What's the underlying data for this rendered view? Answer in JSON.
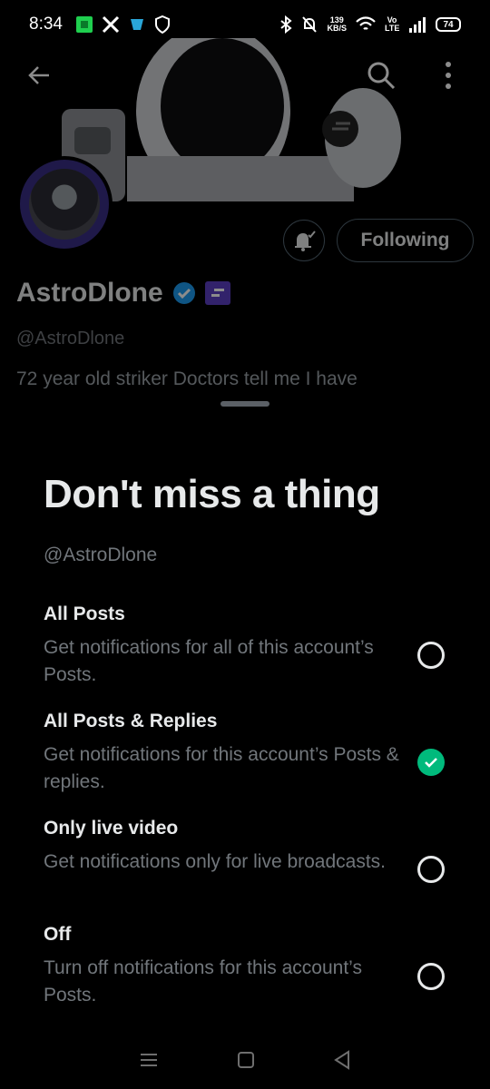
{
  "status_bar": {
    "time": "8:34",
    "net_speed": "139",
    "net_unit": "KB/S",
    "volte": "Vo LTE",
    "battery": "74"
  },
  "profile": {
    "display_name": "AstroDlone",
    "handle": "@AstroDlone",
    "bio": "72 year old striker  Doctors tell me I have",
    "following_label": "Following"
  },
  "sheet": {
    "title": "Don't miss a thing",
    "handle": "@AstroDlone",
    "options": [
      {
        "title": "All Posts",
        "desc": "Get notifications for all of this account’s Posts.",
        "selected": false
      },
      {
        "title": "All Posts & Replies",
        "desc": "Get notifications for this account’s Posts & replies.",
        "selected": true
      },
      {
        "title": "Only live video",
        "desc": "Get notifications only for live broadcasts.",
        "selected": false
      },
      {
        "title": "Off",
        "desc": "Turn off notifications for this account’s Posts.",
        "selected": false
      }
    ]
  },
  "colors": {
    "accent_green": "#00ba7c",
    "verified_blue": "#1d9bf0",
    "affiliate_purple": "#5b3fc4"
  }
}
